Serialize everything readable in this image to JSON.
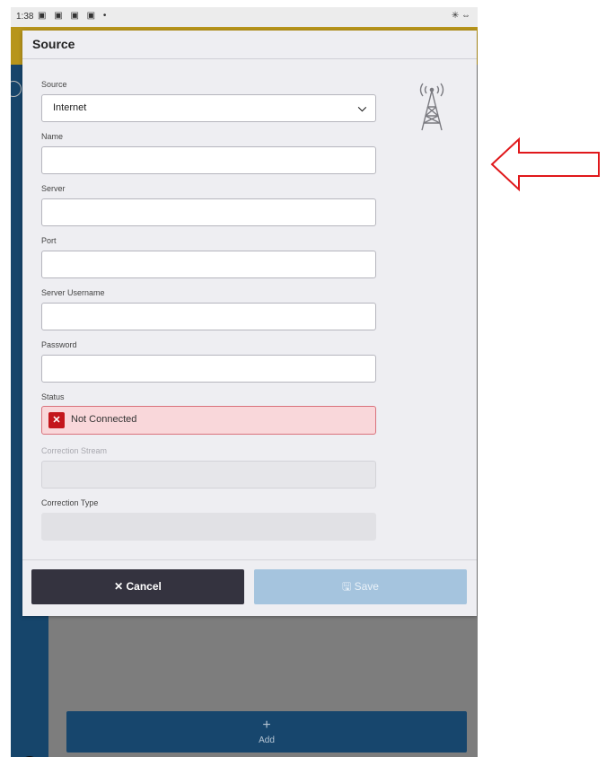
{
  "statusbar": {
    "time": "1:38",
    "icons": "▣ ▣ ▣ ▣ •",
    "right": "✳ ⇔"
  },
  "dialog": {
    "title": "Source",
    "fields": {
      "source": {
        "label": "Source",
        "value": "Internet"
      },
      "name": {
        "label": "Name",
        "value": ""
      },
      "server": {
        "label": "Server",
        "value": ""
      },
      "port": {
        "label": "Port",
        "value": ""
      },
      "server_username": {
        "label": "Server Username",
        "value": ""
      },
      "password": {
        "label": "Password",
        "value": ""
      },
      "status": {
        "label": "Status",
        "value": "Not Connected",
        "icon": "x-icon"
      },
      "correction_stream": {
        "label": "Correction Stream",
        "value": ""
      },
      "correction_type": {
        "label": "Correction Type",
        "value": ""
      }
    },
    "cancel_label": "✕ Cancel",
    "save_label": "🖫 Save"
  },
  "background": {
    "add_plus": "+",
    "add_label": "Add"
  },
  "colors": {
    "header": "#b7951b",
    "sidebar": "#16456b",
    "cancel_bg": "#34333f",
    "save_bg": "#a5c4de",
    "error_bg": "#f9d7da",
    "error_icon": "#c4161c",
    "annotation_arrow": "#e0181b"
  }
}
